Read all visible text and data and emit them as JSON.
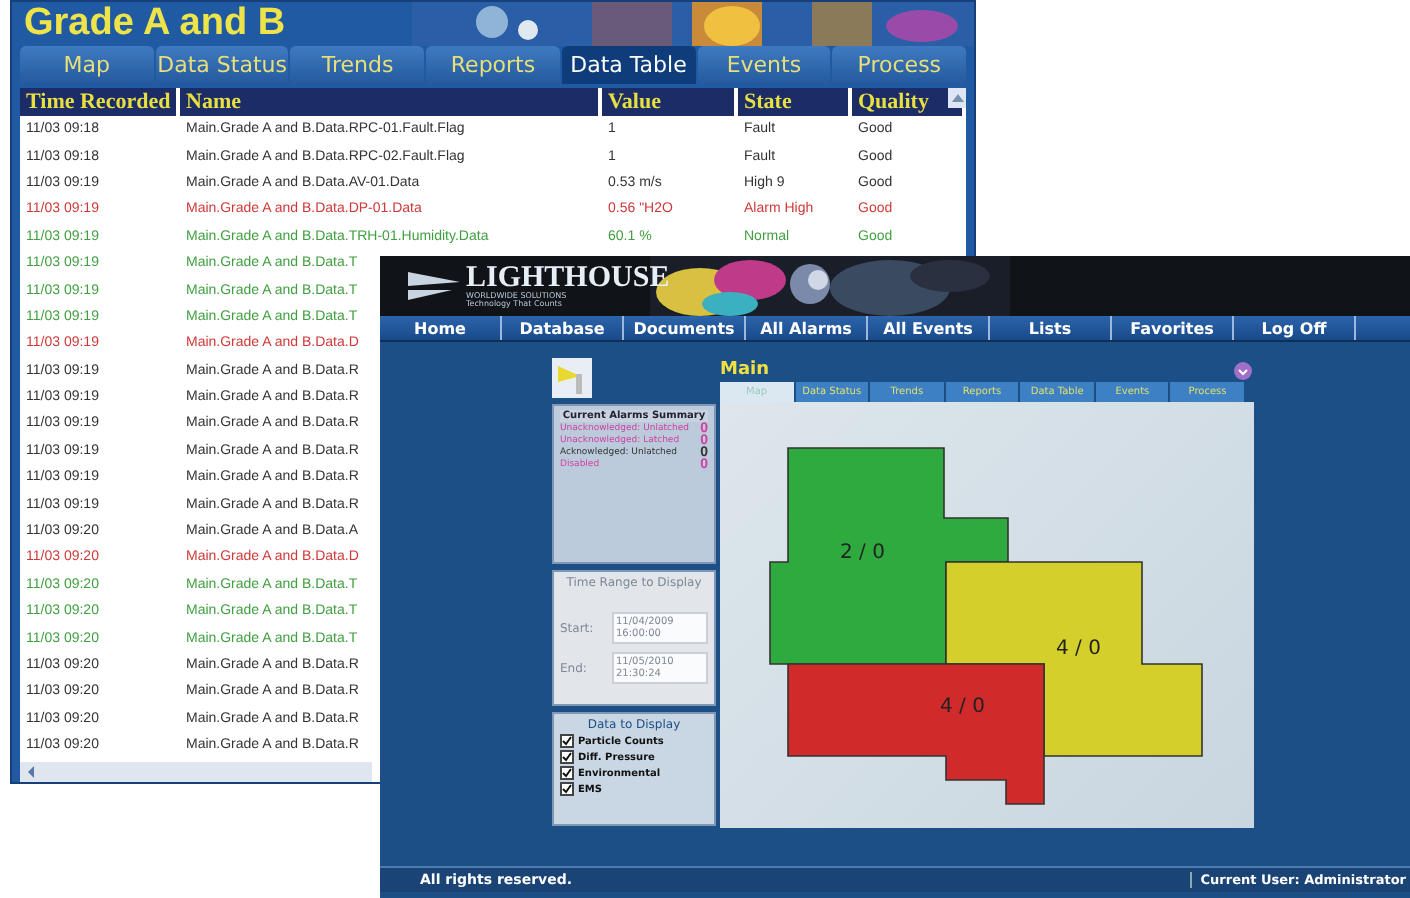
{
  "back_window": {
    "title": "Grade A and B",
    "tabs": [
      {
        "label": "Map",
        "selected": false
      },
      {
        "label": "Data Status",
        "selected": false
      },
      {
        "label": "Trends",
        "selected": false
      },
      {
        "label": "Reports",
        "selected": false
      },
      {
        "label": "Data Table",
        "selected": true
      },
      {
        "label": "Events",
        "selected": false
      },
      {
        "label": "Process",
        "selected": false
      }
    ],
    "table": {
      "columns": [
        "Time Recorded",
        "Name",
        "Value",
        "State",
        "Quality"
      ],
      "rows": [
        {
          "color": "#333333",
          "cells": [
            "11/03 09:18",
            "Main.Grade A and B.Data.RPC-01.Fault.Flag",
            "1",
            "Fault",
            "Good"
          ]
        },
        {
          "color": "#333333",
          "cells": [
            "11/03 09:18",
            "Main.Grade A and B.Data.RPC-02.Fault.Flag",
            "1",
            "Fault",
            "Good"
          ]
        },
        {
          "color": "#333333",
          "cells": [
            "11/03 09:19",
            "Main.Grade A and B.Data.AV-01.Data",
            "0.53 m/s",
            "High 9",
            "Good"
          ]
        },
        {
          "color": "#d03838",
          "cells": [
            "11/03 09:19",
            "Main.Grade A and B.Data.DP-01.Data",
            "0.56 \"H2O",
            "Alarm High",
            "Good"
          ]
        },
        {
          "color": "#3f9f3f",
          "cells": [
            "11/03 09:19",
            "Main.Grade A and B.Data.TRH-01.Humidity.Data",
            "60.1 %",
            "Normal",
            "Good"
          ]
        },
        {
          "color": "#3f9f3f",
          "cells": [
            "11/03 09:19",
            "Main.Grade A and B.Data.T"
          ]
        },
        {
          "color": "#3f9f3f",
          "cells": [
            "11/03 09:19",
            "Main.Grade A and B.Data.T"
          ]
        },
        {
          "color": "#3f9f3f",
          "cells": [
            "11/03 09:19",
            "Main.Grade A and B.Data.T"
          ]
        },
        {
          "color": "#d03838",
          "cells": [
            "11/03 09:19",
            "Main.Grade A and B.Data.D"
          ]
        },
        {
          "color": "#333333",
          "cells": [
            "11/03 09:19",
            "Main.Grade A and B.Data.R"
          ]
        },
        {
          "color": "#333333",
          "cells": [
            "11/03 09:19",
            "Main.Grade A and B.Data.R"
          ]
        },
        {
          "color": "#333333",
          "cells": [
            "11/03 09:19",
            "Main.Grade A and B.Data.R"
          ]
        },
        {
          "color": "#333333",
          "cells": [
            "11/03 09:19",
            "Main.Grade A and B.Data.R"
          ]
        },
        {
          "color": "#333333",
          "cells": [
            "11/03 09:19",
            "Main.Grade A and B.Data.R"
          ]
        },
        {
          "color": "#333333",
          "cells": [
            "11/03 09:19",
            "Main.Grade A and B.Data.R"
          ]
        },
        {
          "color": "#333333",
          "cells": [
            "11/03 09:20",
            "Main.Grade A and B.Data.A"
          ]
        },
        {
          "color": "#d03838",
          "cells": [
            "11/03 09:20",
            "Main.Grade A and B.Data.D"
          ]
        },
        {
          "color": "#3f9f3f",
          "cells": [
            "11/03 09:20",
            "Main.Grade A and B.Data.T"
          ]
        },
        {
          "color": "#3f9f3f",
          "cells": [
            "11/03 09:20",
            "Main.Grade A and B.Data.T"
          ]
        },
        {
          "color": "#3f9f3f",
          "cells": [
            "11/03 09:20",
            "Main.Grade A and B.Data.T"
          ]
        },
        {
          "color": "#333333",
          "cells": [
            "11/03 09:20",
            "Main.Grade A and B.Data.R"
          ]
        },
        {
          "color": "#333333",
          "cells": [
            "11/03 09:20",
            "Main.Grade A and B.Data.R"
          ]
        },
        {
          "color": "#333333",
          "cells": [
            "11/03 09:20",
            "Main.Grade A and B.Data.R"
          ]
        },
        {
          "color": "#333333",
          "cells": [
            "11/03 09:20",
            "Main.Grade A and B.Data.R"
          ]
        }
      ]
    }
  },
  "front_window": {
    "logo": {
      "name": "LIGHTHOUSE",
      "line_1": "WORLDWIDE SOLUTIONS",
      "line_2": "Technology That Counts"
    },
    "nav": [
      "Home",
      "Database",
      "Documents",
      "All Alarms",
      "All Events",
      "Lists",
      "Favorites",
      "Log Off"
    ],
    "alarm_summary": {
      "title": "Current Alarms Summary",
      "items": [
        {
          "label": "Unacknowledged: Unlatched",
          "count": "0",
          "color": "#d040a0"
        },
        {
          "label": "Unacknowledged: Latched",
          "count": "0",
          "color": "#d040a0"
        },
        {
          "label": "Acknowledged: Unlatched",
          "count": "0",
          "color": "#333333"
        },
        {
          "label": "Disabled",
          "count": "0",
          "color": "#d040a0"
        }
      ]
    },
    "time_range": {
      "title": "Time Range to Display",
      "start_label": "Start:",
      "start": "11/04/2009 16:00:00",
      "end_label": "End:",
      "end": "11/05/2010 21:30:24"
    },
    "data_to_display": {
      "title": "Data to Display",
      "options": [
        {
          "label": "Particle Counts",
          "checked": true
        },
        {
          "label": "Diff. Pressure",
          "checked": true
        },
        {
          "label": "Environmental",
          "checked": true
        },
        {
          "label": "EMS",
          "checked": true
        }
      ]
    },
    "main": {
      "title": "Main",
      "tabs": [
        {
          "label": "Map",
          "selected": true
        },
        {
          "label": "Data Status",
          "selected": false
        },
        {
          "label": "Trends",
          "selected": false
        },
        {
          "label": "Reports",
          "selected": false
        },
        {
          "label": "Data Table",
          "selected": false
        },
        {
          "label": "Events",
          "selected": false
        },
        {
          "label": "Process",
          "selected": false
        }
      ],
      "rooms": [
        {
          "label": "2 / 0",
          "color": "#2faa3f"
        },
        {
          "label": "4 / 0",
          "color": "#d4cf2a"
        },
        {
          "label": "4 / 0",
          "color": "#d02a2a"
        }
      ]
    },
    "footer": {
      "left": "All rights reserved.",
      "right": "Current User: Administrator"
    }
  }
}
